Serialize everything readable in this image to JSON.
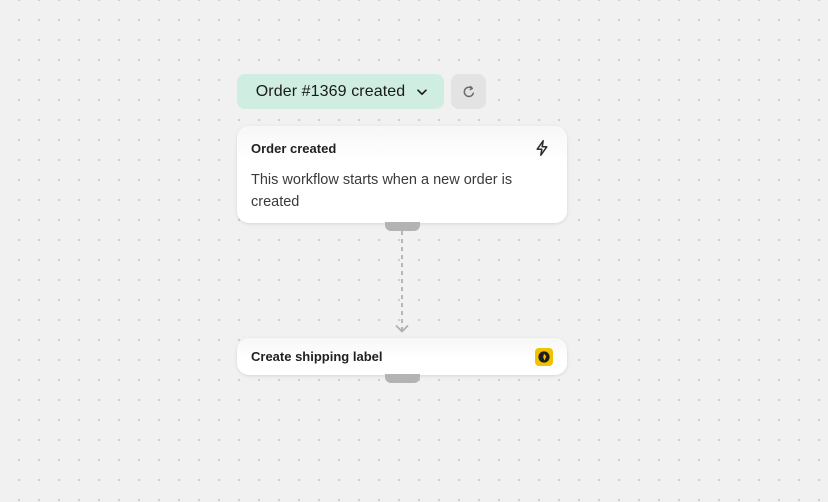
{
  "run_selector": {
    "label": "Order #1369 created",
    "background": "#cfeee1",
    "icon": "chevron-down-icon"
  },
  "refresh": {
    "icon": "refresh-icon"
  },
  "trigger_card": {
    "title": "Order created",
    "description": "This workflow starts when a new order is created",
    "icon": "bolt-icon"
  },
  "action_card": {
    "title": "Create shipping label",
    "icon": "shipping-app-icon",
    "icon_color": "#f2c200"
  },
  "connector": {
    "style": "dashed",
    "color": "#b0b0b0"
  }
}
